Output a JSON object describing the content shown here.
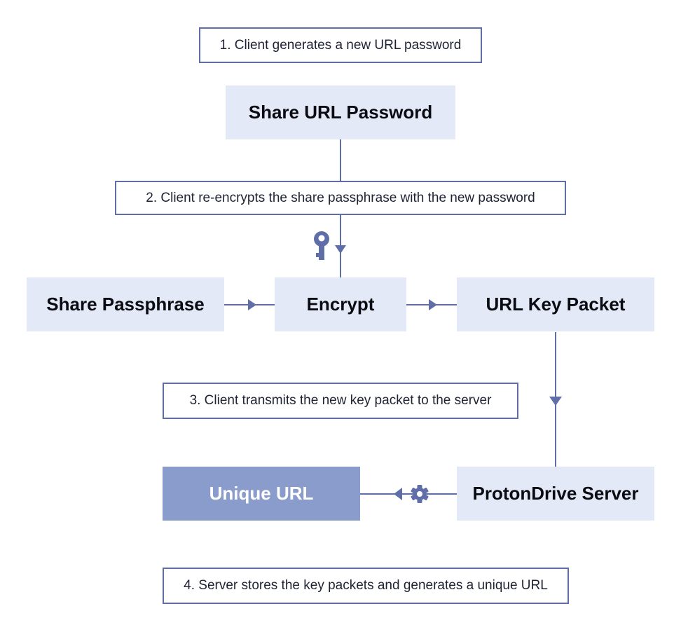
{
  "steps": {
    "s1": "1. Client generates a new URL password",
    "s2": "2. Client re-encrypts the share passphrase with the new password",
    "s3": "3. Client transmits the new key packet to the server",
    "s4": "4. Server stores the key packets and generates a unique URL"
  },
  "nodes": {
    "share_url_password": "Share URL Password",
    "share_passphrase": "Share Passphrase",
    "encrypt": "Encrypt",
    "url_key_packet": "URL Key Packet",
    "protondrive_server": "ProtonDrive Server",
    "unique_url": "Unique URL"
  },
  "icons": {
    "key": "key-icon",
    "gear": "gear-icon"
  },
  "colors": {
    "line": "#5f6ea8",
    "node_fill": "#e4e9f8",
    "highlight_fill": "#8a9ccb"
  }
}
